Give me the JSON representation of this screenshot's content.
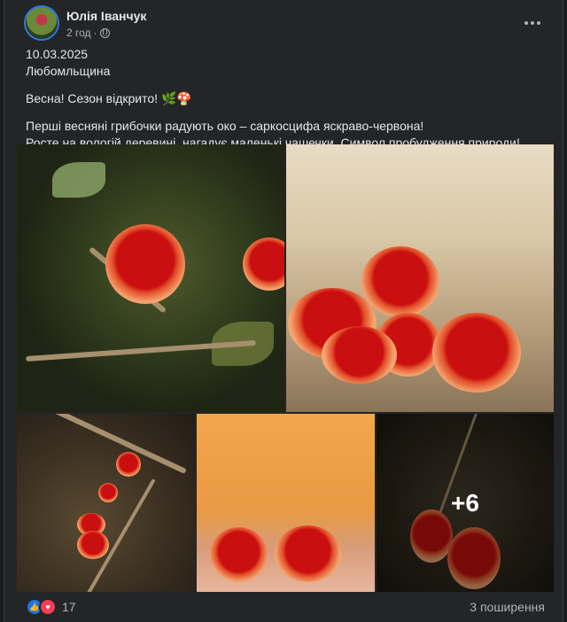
{
  "post": {
    "author": "Юлія Іванчук",
    "time": "2 год",
    "separator": "·",
    "date": "10.03.2025",
    "location": "Любомльщина",
    "line1": "Весна! Сезон відкрито! 🌿🍄",
    "line2": "Перші весняні грибочки радують око – саркосцифа яскраво-червона!",
    "line3": "Росте на вологій деревині, нагадує маленькі чашечки. Символ пробудження природи!"
  },
  "gallery": {
    "more_count": "+6"
  },
  "footer": {
    "reaction_count": "17",
    "shares": "3 поширення"
  },
  "icons": {
    "privacy": "globe-icon",
    "menu": "more-icon",
    "like": "like-icon",
    "love": "love-icon"
  },
  "colors": {
    "background": "#242526",
    "text": "#e4e6eb",
    "secondary": "#b0b3b8",
    "like": "#1b74e4",
    "love": "#f33e58"
  }
}
